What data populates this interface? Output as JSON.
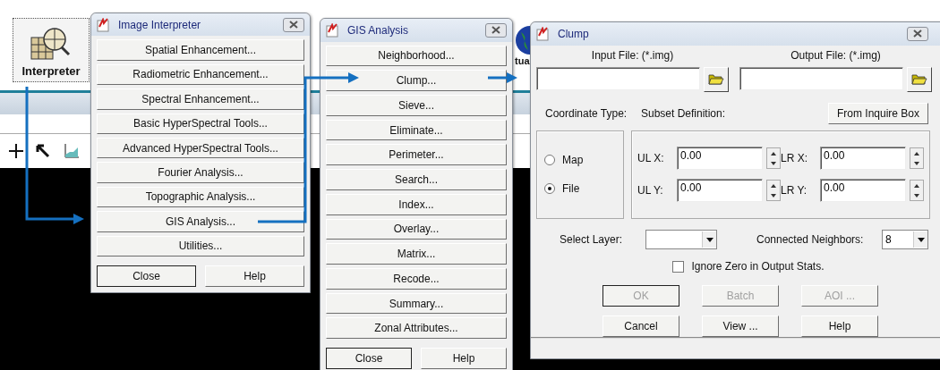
{
  "toolbar": {
    "interpreter_button": {
      "label": "Interpreter"
    },
    "cut_label": "tua"
  },
  "image_interpreter": {
    "title": "Image Interpreter",
    "items": [
      "Spatial Enhancement...",
      "Radiometric Enhancement...",
      "Spectral Enhancement...",
      "Basic HyperSpectral Tools...",
      "Advanced HyperSpectral Tools...",
      "Fourier Analysis...",
      "Topographic Analysis...",
      "GIS Analysis...",
      "Utilities..."
    ],
    "buttons": [
      {
        "label": "Close",
        "default": true
      },
      {
        "label": "Help",
        "default": false
      }
    ]
  },
  "gis_analysis": {
    "title": "GIS Analysis",
    "items": [
      "Neighborhood...",
      "Clump...",
      "Sieve...",
      "Eliminate...",
      "Perimeter...",
      "Search...",
      "Index...",
      "Overlay...",
      "Matrix...",
      "Recode...",
      "Summary...",
      "Zonal Attributes..."
    ],
    "buttons": [
      {
        "label": "Close",
        "default": true
      },
      {
        "label": "Help",
        "default": false
      }
    ]
  },
  "clump": {
    "title": "Clump",
    "input_file": {
      "label": "Input File: (*.img)"
    },
    "output_file": {
      "label": "Output File: (*.img)"
    },
    "coordinate_type": {
      "label": "Coordinate Type:",
      "options": [
        {
          "label": "Map",
          "selected": false
        },
        {
          "label": "File",
          "selected": true
        }
      ]
    },
    "subset": {
      "label": "Subset Definition:",
      "button": "From Inquire Box",
      "fields": [
        {
          "label": "UL X:",
          "value": "0.00"
        },
        {
          "label": "LR X:",
          "value": "0.00"
        },
        {
          "label": "UL Y:",
          "value": "0.00"
        },
        {
          "label": "LR Y:",
          "value": "0.00"
        }
      ]
    },
    "select_layer": {
      "label": "Select Layer:"
    },
    "connected_neighbors": {
      "label": "Connected Neighbors:",
      "value": "8"
    },
    "ignore_zero": {
      "label": "Ignore Zero in Output Stats.",
      "checked": false
    },
    "buttons": [
      {
        "label": "OK",
        "disabled": true,
        "default": true
      },
      {
        "label": "Batch",
        "disabled": true,
        "default": false
      },
      {
        "label": "AOI ...",
        "disabled": true,
        "default": false
      },
      {
        "label": "Cancel",
        "disabled": false,
        "default": false
      },
      {
        "label": "View ...",
        "disabled": false,
        "default": false
      },
      {
        "label": "Help",
        "disabled": false,
        "default": false
      }
    ]
  }
}
